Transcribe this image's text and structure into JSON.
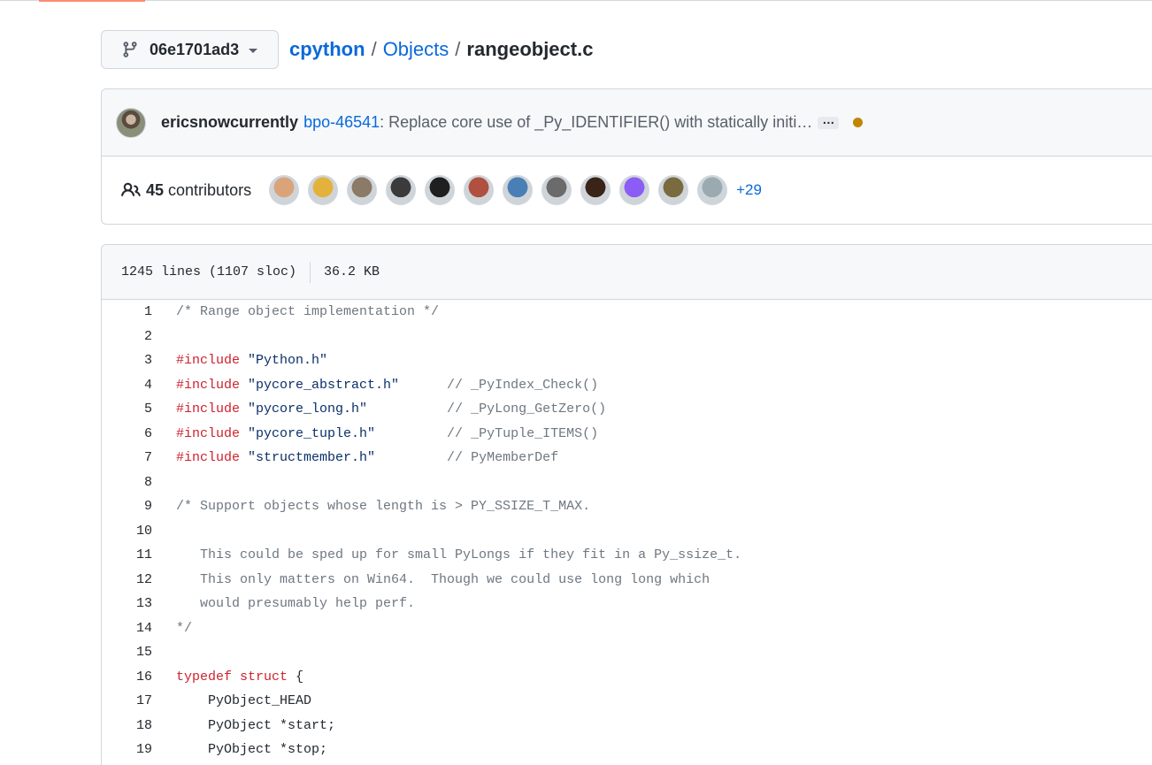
{
  "branch": {
    "name": "06e1701ad3"
  },
  "breadcrumb": {
    "repo": "cpython",
    "dir": "Objects",
    "file": "rangeobject.c",
    "sep": "/"
  },
  "commit": {
    "author": "ericsnowcurrently",
    "issue_link": "bpo-46541",
    "message": ": Replace core use of _Py_IDENTIFIER() with statically initi…",
    "ellipsis": "…"
  },
  "contributors": {
    "count": "45",
    "label": "contributors",
    "more": "+29",
    "avatar_colors": [
      "#d9a47a",
      "#e3b23c",
      "#8a7a66",
      "#3b3b3b",
      "#1f1f1f",
      "#b05040",
      "#4a7fb5",
      "#6b6b6b",
      "#3a2418",
      "#8b5cf6",
      "#7a6a40",
      "#9aaab0"
    ]
  },
  "file_info": {
    "lines": "1245 lines (1107 sloc)",
    "size": "36.2 KB"
  },
  "code_lines": [
    {
      "n": "1",
      "tokens": [
        {
          "t": "/* Range object implementation */",
          "c": "comment"
        }
      ]
    },
    {
      "n": "2",
      "tokens": []
    },
    {
      "n": "3",
      "tokens": [
        {
          "t": "#include",
          "c": "kw"
        },
        {
          "t": " \"Python.h\"",
          "c": "str"
        }
      ]
    },
    {
      "n": "4",
      "tokens": [
        {
          "t": "#include",
          "c": "kw"
        },
        {
          "t": " \"pycore_abstract.h\"",
          "c": "str"
        },
        {
          "t": "      // _PyIndex_Check()",
          "c": "comment"
        }
      ]
    },
    {
      "n": "5",
      "tokens": [
        {
          "t": "#include",
          "c": "kw"
        },
        {
          "t": " \"pycore_long.h\"",
          "c": "str"
        },
        {
          "t": "          // _PyLong_GetZero()",
          "c": "comment"
        }
      ]
    },
    {
      "n": "6",
      "tokens": [
        {
          "t": "#include",
          "c": "kw"
        },
        {
          "t": " \"pycore_tuple.h\"",
          "c": "str"
        },
        {
          "t": "         // _PyTuple_ITEMS()",
          "c": "comment"
        }
      ]
    },
    {
      "n": "7",
      "tokens": [
        {
          "t": "#include",
          "c": "kw"
        },
        {
          "t": " \"structmember.h\"",
          "c": "str"
        },
        {
          "t": "         // PyMemberDef",
          "c": "comment"
        }
      ]
    },
    {
      "n": "8",
      "tokens": []
    },
    {
      "n": "9",
      "tokens": [
        {
          "t": "/* Support objects whose length is > PY_SSIZE_T_MAX.",
          "c": "comment"
        }
      ]
    },
    {
      "n": "10",
      "tokens": []
    },
    {
      "n": "11",
      "tokens": [
        {
          "t": "   This could be sped up for small PyLongs if they fit in a Py_ssize_t.",
          "c": "comment"
        }
      ]
    },
    {
      "n": "12",
      "tokens": [
        {
          "t": "   This only matters on Win64.  Though we could use long long which",
          "c": "comment"
        }
      ]
    },
    {
      "n": "13",
      "tokens": [
        {
          "t": "   would presumably help perf.",
          "c": "comment"
        }
      ]
    },
    {
      "n": "14",
      "tokens": [
        {
          "t": "*/",
          "c": "comment"
        }
      ]
    },
    {
      "n": "15",
      "tokens": []
    },
    {
      "n": "16",
      "tokens": [
        {
          "t": "typedef",
          "c": "kw"
        },
        {
          "t": " ",
          "c": "plain"
        },
        {
          "t": "struct",
          "c": "kw"
        },
        {
          "t": " {",
          "c": "plain"
        }
      ]
    },
    {
      "n": "17",
      "tokens": [
        {
          "t": "    PyObject_HEAD",
          "c": "plain"
        }
      ]
    },
    {
      "n": "18",
      "tokens": [
        {
          "t": "    PyObject *start;",
          "c": "plain"
        }
      ]
    },
    {
      "n": "19",
      "tokens": [
        {
          "t": "    PyObject *stop;",
          "c": "plain"
        }
      ]
    }
  ],
  "colors": {
    "link": "#0969da",
    "keyword": "#cf222e",
    "comment": "#6e7781",
    "string": "#0a3069",
    "status": "#bf8700"
  }
}
